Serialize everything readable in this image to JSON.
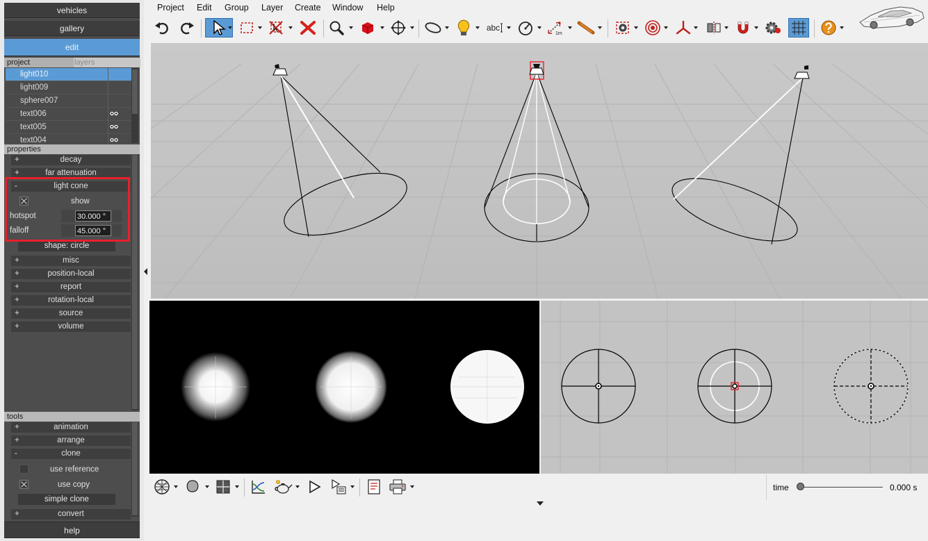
{
  "sidebar": {
    "nav": {
      "vehicles": "vehicles",
      "gallery": "gallery",
      "edit": "edit"
    },
    "project_tab": "project",
    "layers_tab": "layers",
    "project_items": [
      "light010",
      "light009",
      "sphere007",
      "text006",
      "text005",
      "text004"
    ],
    "properties_label": "properties",
    "properties": {
      "decay": "decay",
      "far_attenuation": "far attenuation",
      "light_cone": "light cone",
      "show": "show",
      "hotspot_label": "hotspot",
      "hotspot_value": "30.000 °",
      "falloff_label": "falloff",
      "falloff_value": "45.000 °",
      "shape": "shape: circle",
      "misc": "misc",
      "position_local": "position-local",
      "report": "report",
      "rotation_local": "rotation-local",
      "source": "source",
      "volume": "volume"
    },
    "tools_label": "tools",
    "tools": {
      "animation": "animation",
      "arrange": "arrange",
      "clone": "clone",
      "use_reference": "use reference",
      "use_copy": "use copy",
      "simple_clone": "simple clone",
      "convert": "convert"
    },
    "help": "help",
    "plus": "+",
    "minus": "-"
  },
  "menu": [
    "Project",
    "Edit",
    "Group",
    "Layer",
    "Create",
    "Window",
    "Help"
  ],
  "toolbar": {
    "text_tool_label": "abc",
    "measure_label": "1m"
  },
  "timebar": {
    "label": "time",
    "value": "0.000 s",
    "position_fraction": 0.0
  },
  "colors": {
    "accent": "#5b9bd5",
    "highlight": "#e8202a"
  }
}
